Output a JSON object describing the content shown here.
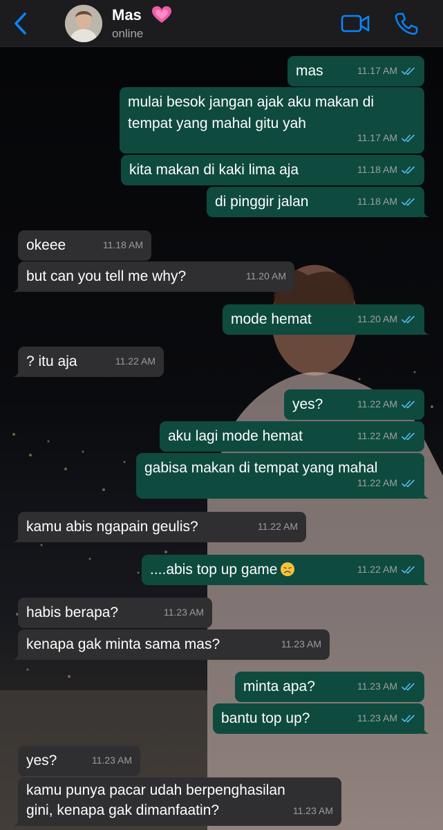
{
  "header": {
    "contact_name": "Mas",
    "status": "online",
    "icons": {
      "back": "chevron-left-icon",
      "heart": "heart-emoji-icon",
      "video": "video-camera-icon",
      "phone": "phone-icon"
    },
    "accent_color": "#0a84ff"
  },
  "colors": {
    "outgoing_bubble": "#0f4a3f",
    "incoming_bubble": "#2f2f31",
    "read_ticks": "#53bdeb"
  },
  "messages": [
    {
      "dir": "out",
      "text": "mas",
      "time": "11.17 AM"
    },
    {
      "dir": "out",
      "text": "mulai besok jangan ajak aku makan di tempat yang mahal gitu yah",
      "time": "11.17 AM"
    },
    {
      "dir": "out",
      "text": "kita makan di kaki lima aja",
      "time": "11.18 AM"
    },
    {
      "dir": "out",
      "text": "di pinggir jalan",
      "time": "11.18 AM"
    },
    {
      "dir": "in",
      "text": "okeee",
      "time": "11.18 AM"
    },
    {
      "dir": "in",
      "text": "but can you tell me why?",
      "time": "11.20 AM"
    },
    {
      "dir": "out",
      "text": "mode hemat",
      "time": "11.20 AM"
    },
    {
      "dir": "in",
      "text": "? itu aja",
      "time": "11.22 AM"
    },
    {
      "dir": "out",
      "text": "yes?",
      "time": "11.22 AM"
    },
    {
      "dir": "out",
      "text": "aku lagi mode hemat",
      "time": "11.22 AM"
    },
    {
      "dir": "out",
      "text": "gabisa makan di tempat yang mahal",
      "time": "11.22 AM"
    },
    {
      "dir": "in",
      "text": "kamu abis ngapain geulis?",
      "time": "11.22 AM"
    },
    {
      "dir": "out",
      "text": "....abis top up game",
      "emoji": "disappointed-face-icon",
      "time": "11.22 AM"
    },
    {
      "dir": "in",
      "text": "habis berapa?",
      "time": "11.23 AM"
    },
    {
      "dir": "in",
      "text": "kenapa gak minta sama mas?",
      "time": "11.23 AM"
    },
    {
      "dir": "out",
      "text": "minta apa?",
      "time": "11.23 AM"
    },
    {
      "dir": "out",
      "text": "bantu top up?",
      "time": "11.23 AM"
    },
    {
      "dir": "in",
      "text": "yes?",
      "time": "11.23 AM"
    },
    {
      "dir": "in",
      "text": "kamu punya pacar udah berpenghasilan gini, kenapa gak dimanfaatin?",
      "time": "11.23 AM"
    }
  ]
}
